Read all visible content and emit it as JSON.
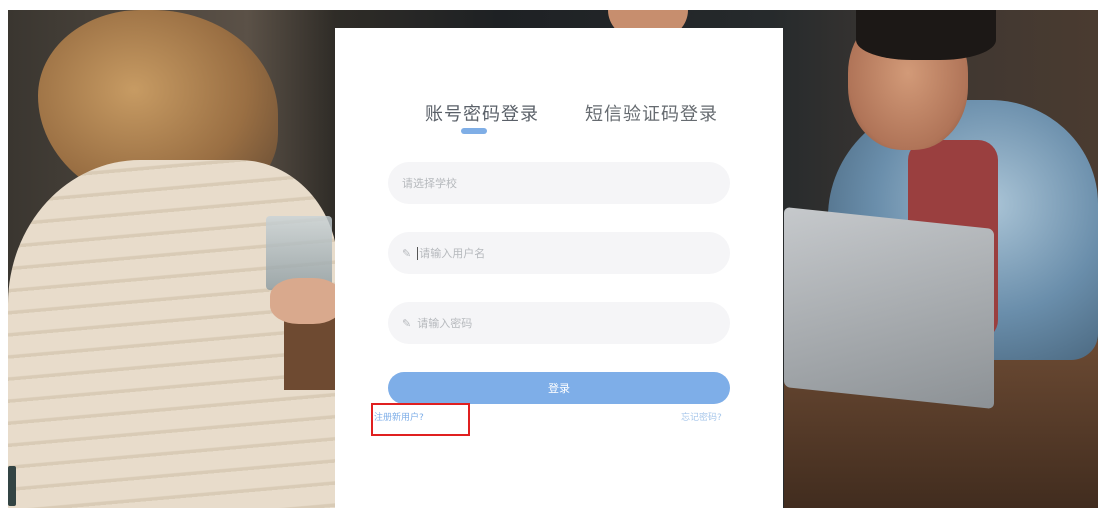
{
  "login": {
    "tabs": [
      {
        "label": "账号密码登录",
        "active": true
      },
      {
        "label": "短信验证码登录",
        "active": false
      }
    ],
    "school_placeholder": "请选择学校",
    "username_placeholder": "请输入用户名",
    "password_placeholder": "请输入密码",
    "field_icon": "pencil-icon",
    "submit_label": "登录",
    "register_link": "注册新用户?",
    "forgot_link": "忘记密码?"
  },
  "colors": {
    "accent": "#7eaee8",
    "highlight": "#e02020",
    "field_bg": "#f5f5f7"
  }
}
